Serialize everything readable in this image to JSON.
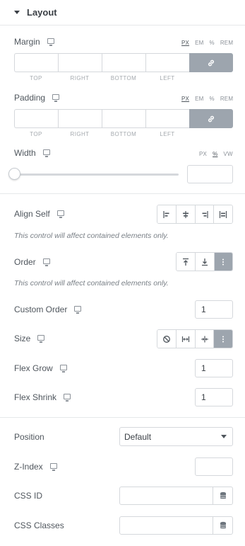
{
  "section": {
    "title": "Layout"
  },
  "margin": {
    "label": "Margin",
    "units": [
      "PX",
      "EM",
      "%",
      "REM"
    ],
    "active_unit": "PX",
    "sides": [
      "TOP",
      "RIGHT",
      "BOTTOM",
      "LEFT"
    ],
    "values": [
      "",
      "",
      "",
      ""
    ]
  },
  "padding": {
    "label": "Padding",
    "units": [
      "PX",
      "EM",
      "%",
      "REM"
    ],
    "active_unit": "PX",
    "sides": [
      "TOP",
      "RIGHT",
      "BOTTOM",
      "LEFT"
    ],
    "values": [
      "",
      "",
      "",
      ""
    ]
  },
  "width": {
    "label": "Width",
    "units": [
      "PX",
      "%",
      "VW"
    ],
    "active_unit": "%",
    "slider_value": 0,
    "value": ""
  },
  "align_self": {
    "label": "Align Self",
    "hint": "This control will affect contained elements only."
  },
  "order": {
    "label": "Order",
    "hint": "This control will affect contained elements only."
  },
  "custom_order": {
    "label": "Custom Order",
    "value": "1"
  },
  "size": {
    "label": "Size"
  },
  "flex_grow": {
    "label": "Flex Grow",
    "value": "1"
  },
  "flex_shrink": {
    "label": "Flex Shrink",
    "value": "1"
  },
  "position": {
    "label": "Position",
    "selected": "Default"
  },
  "z_index": {
    "label": "Z-Index",
    "value": ""
  },
  "css_id": {
    "label": "CSS ID",
    "value": ""
  },
  "css_classes": {
    "label": "CSS Classes",
    "value": ""
  },
  "colors": {
    "accent_gray": "#9da5ae",
    "border": "#d5d8dc",
    "text": "#4f565d"
  }
}
